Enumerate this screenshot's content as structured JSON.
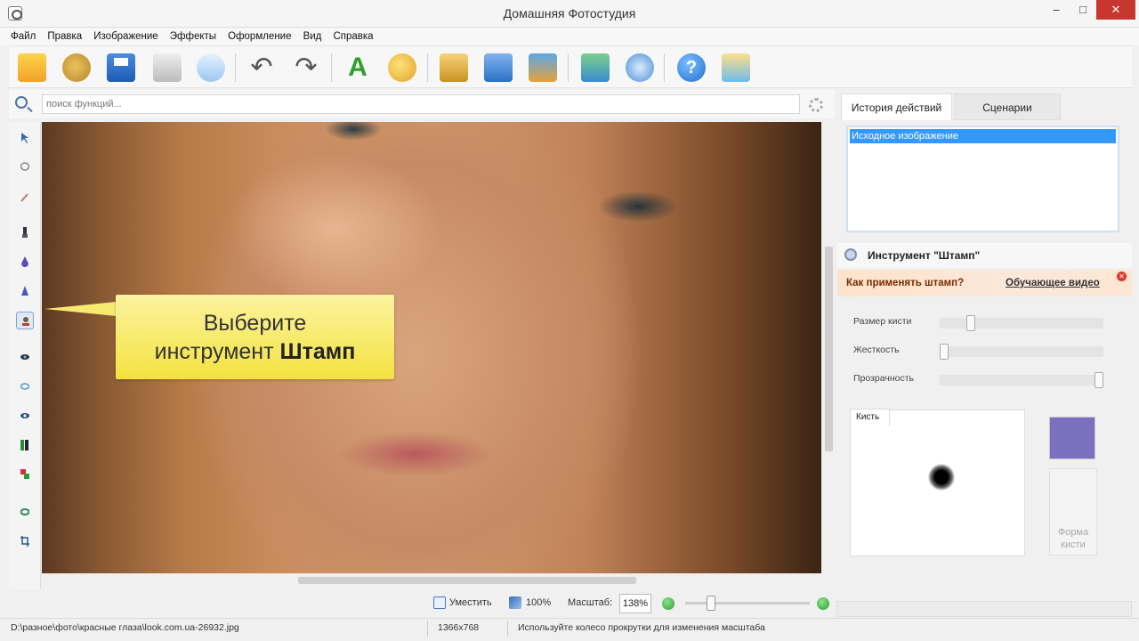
{
  "window": {
    "title": "Домашняя Фотостудия",
    "minimize": "–",
    "maximize": "□",
    "close": "✕"
  },
  "menu": [
    "Файл",
    "Правка",
    "Изображение",
    "Эффекты",
    "Оформление",
    "Вид",
    "Справка"
  ],
  "toolbar": {
    "icons": [
      "open-icon",
      "cookie-icon",
      "save-icon",
      "print-icon",
      "preview-icon",
      "undo-icon",
      "redo-icon",
      "text-icon",
      "palette-icon",
      "frame-icon",
      "calendar-icon",
      "collage-icon",
      "expand-icon",
      "zoom-fit-icon",
      "help-icon",
      "share-icon"
    ],
    "text_glyph": "A",
    "undo_glyph": "↶",
    "redo_glyph": "↷",
    "help_glyph": "?"
  },
  "search": {
    "placeholder": "поиск функций..."
  },
  "left_tools": [
    "pointer-tool",
    "lasso-tool",
    "magic-wand-tool",
    "brush-tool",
    "drop-tool",
    "pencil-tool",
    "stamp-tool",
    "eye-tool",
    "blur-tool",
    "redeye-tool",
    "levels-tool",
    "color-tool",
    "eraser-tool",
    "crop-tool"
  ],
  "callout": {
    "line1": "Выберите",
    "line2_prefix": "инструмент ",
    "line2_bold": "Штамп"
  },
  "right_panel": {
    "tabs": [
      "История действий",
      "Сценарии"
    ],
    "history_items": [
      "Исходное изображение"
    ],
    "tool_title": "Инструмент \"Штамп\"",
    "question": "Как применять штамп?",
    "video_link": "Обучающее видео",
    "sliders": [
      {
        "label": "Размер кисти",
        "value": 0.17
      },
      {
        "label": "Жесткость",
        "value": 0.0
      },
      {
        "label": "Прозрачность",
        "value": 1.0
      }
    ],
    "brush_tab": "Кисть",
    "brush_color": "#7b70c0",
    "brush_shape_label_1": "Форма",
    "brush_shape_label_2": "кисти"
  },
  "zoombar": {
    "fit": "Уместить",
    "actual": "100%",
    "scale_label": "Масштаб:",
    "scale_value": "138%",
    "zoom_level": 0.17
  },
  "status": {
    "path": "D:\\разное\\фото\\красные глаза\\look.com.ua-26932.jpg",
    "dims": "1366x768",
    "hint": "Используйте колесо прокрутки для изменения масштаба"
  }
}
